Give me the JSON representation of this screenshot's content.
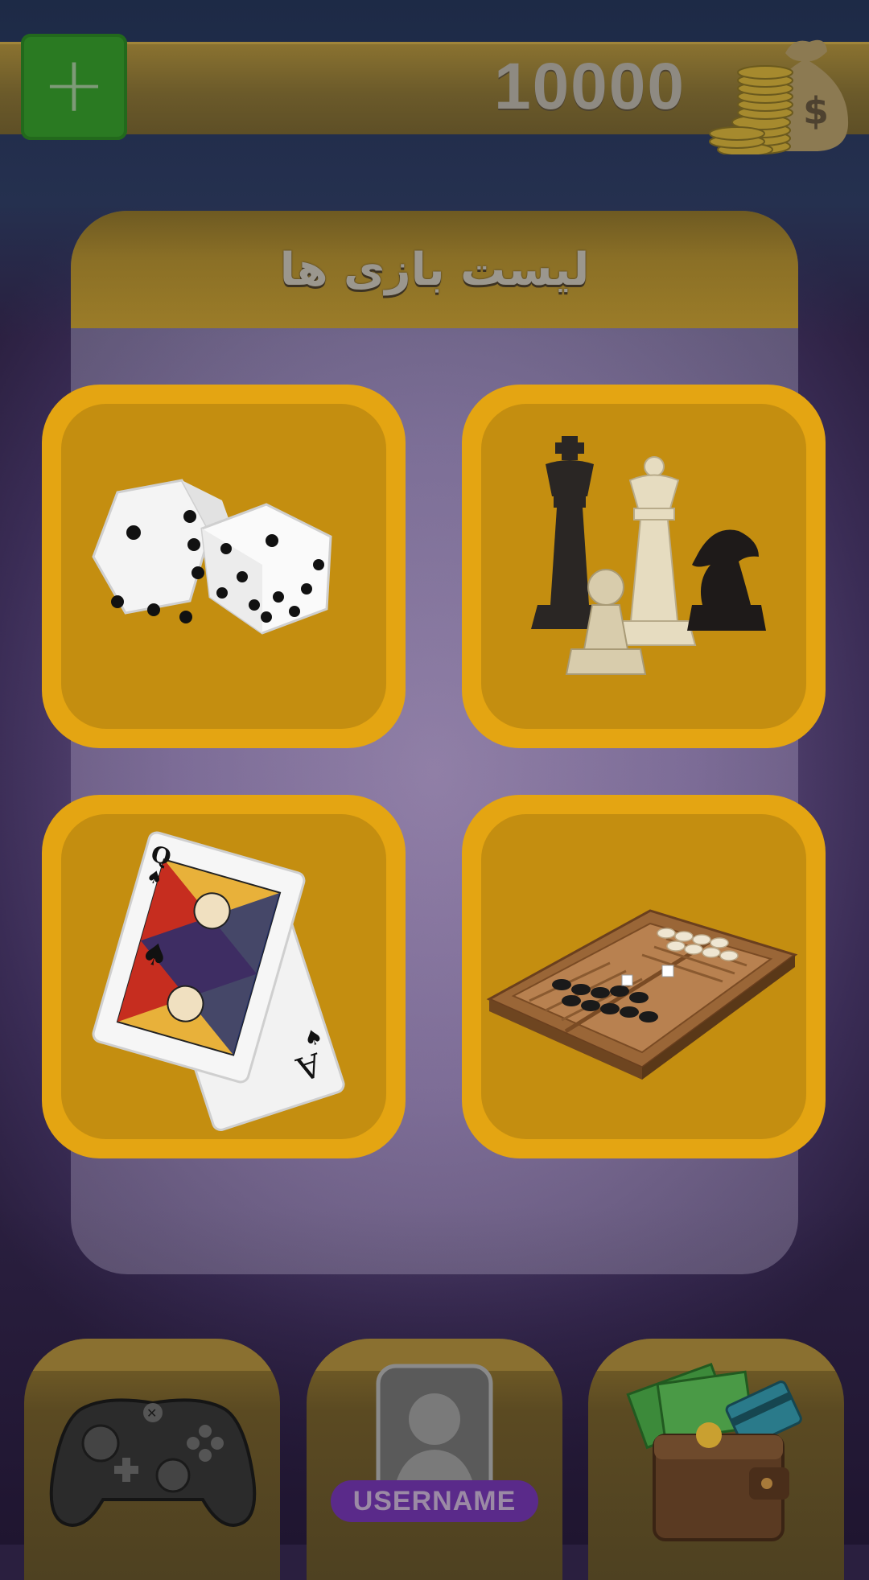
{
  "header": {
    "coin_balance": "10000",
    "add_button_symbol": "+",
    "coin_icon": "coins-money-bag-icon"
  },
  "panel": {
    "title": "لیست بازی ها"
  },
  "games": [
    {
      "id": "dice",
      "icon": "dice-icon"
    },
    {
      "id": "chess",
      "icon": "chess-pieces-icon"
    },
    {
      "id": "cards",
      "icon": "playing-cards-icon"
    },
    {
      "id": "backgammon",
      "icon": "backgammon-board-icon"
    }
  ],
  "bottom_nav": {
    "games_icon": "gamepad-icon",
    "profile_icon": "avatar-icon",
    "username": "USERNAME",
    "wallet_icon": "wallet-icon"
  },
  "colors": {
    "tile_outer": "#e4a512",
    "tile_inner": "#c48e10",
    "add_button": "#2a7a22",
    "username_pill": "#5a2a8a"
  }
}
